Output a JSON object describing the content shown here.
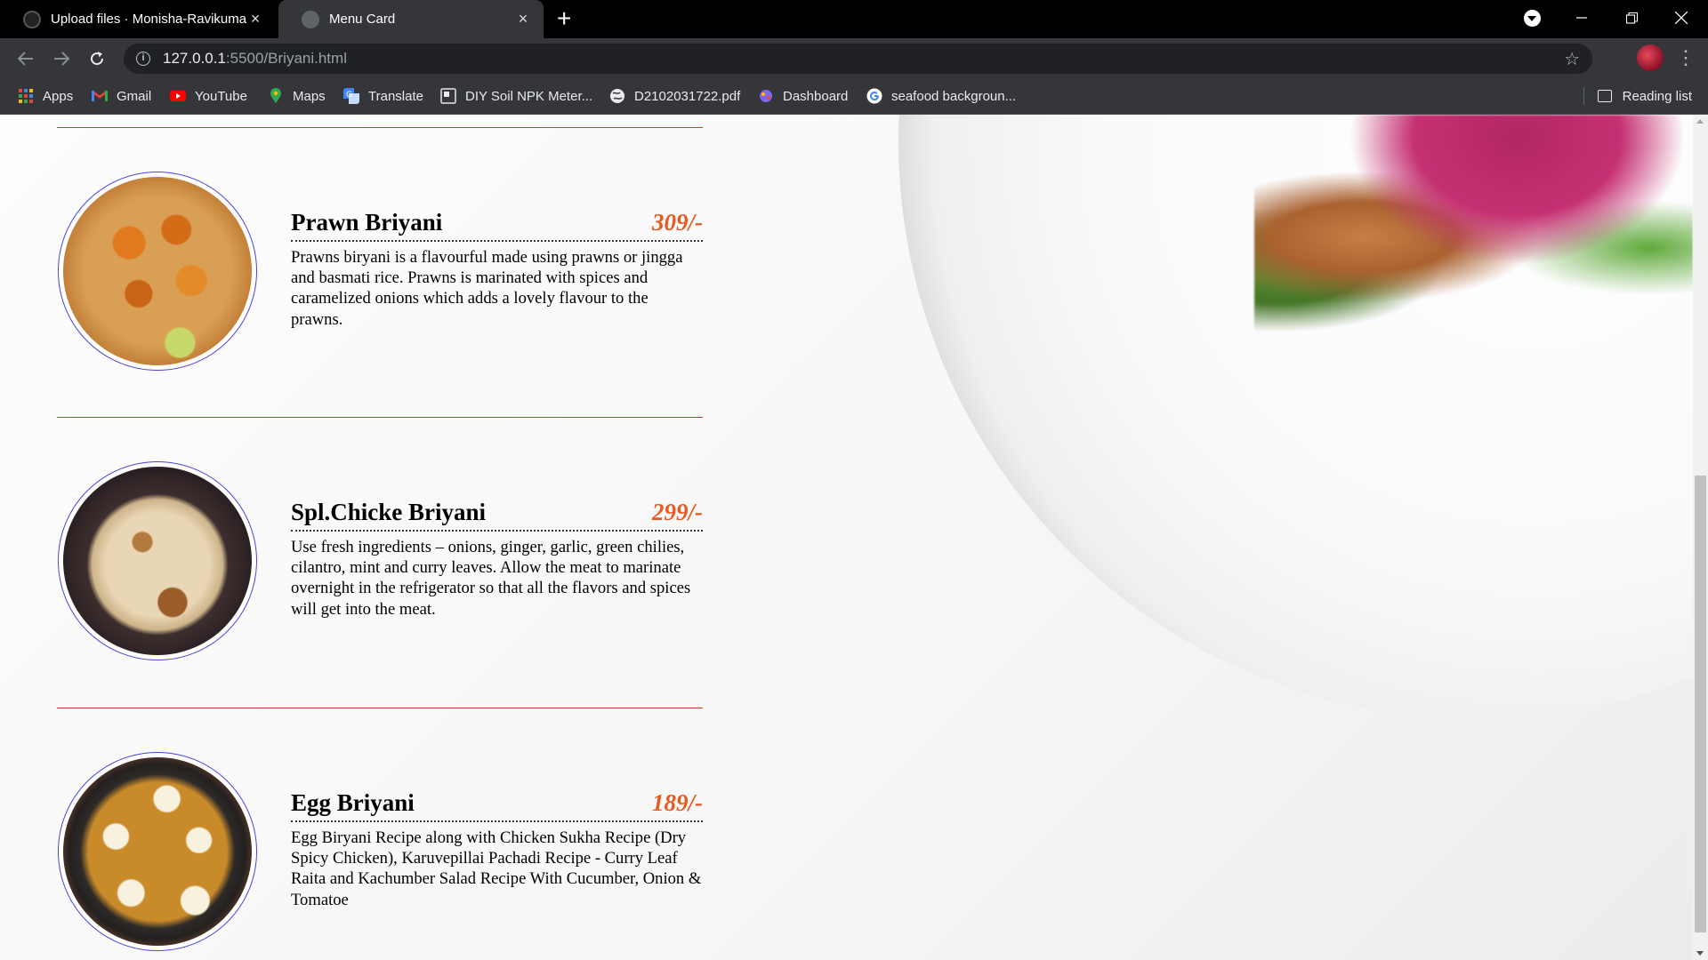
{
  "browser": {
    "tabs": [
      {
        "title": "Upload files · Monisha-Ravikumar",
        "active": false,
        "close": "×",
        "favicon": "github-icon"
      },
      {
        "title": "Menu Card",
        "active": true,
        "close": "×",
        "favicon": "globe-icon"
      }
    ],
    "new_tab": "+",
    "url_host": "127.0.0.1",
    "url_path": ":5500/Briyani.html",
    "bookmarks": [
      {
        "label": "Apps",
        "icon": "apps-grid-icon",
        "color": "#ea4335"
      },
      {
        "label": "Gmail",
        "icon": "gmail-icon",
        "color": "#ea4335"
      },
      {
        "label": "YouTube",
        "icon": "youtube-icon",
        "color": "#ff0000"
      },
      {
        "label": "Maps",
        "icon": "maps-pin-icon",
        "color": "#34a853"
      },
      {
        "label": "Translate",
        "icon": "translate-icon",
        "color": "#4285f4"
      },
      {
        "label": "DIY Soil NPK Meter...",
        "icon": "page-icon",
        "color": "#9aa0a6"
      },
      {
        "label": "D2102031722.pdf",
        "icon": "globe-icon",
        "color": "#e8eaed"
      },
      {
        "label": "Dashboard",
        "icon": "dashboard-icon",
        "color": "#7b68ee"
      },
      {
        "label": "seafood backgroun...",
        "icon": "google-icon",
        "color": "#4285f4"
      }
    ],
    "reading_list": "Reading list"
  },
  "menu": {
    "items": [
      {
        "name": "Prawn Briyani",
        "price": "309/-",
        "description": "Prawns biryani is a flavourful made using prawns or jingga and basmati rice. Prawns is marinated with spices and caramelized onions which adds a lovely flavour to the prawns."
      },
      {
        "name": "Spl.Chicke Briyani",
        "price": "299/-",
        "description": "Use fresh ingredients – onions, ginger, garlic, green chilies, cilantro, mint and curry leaves. Allow the meat to marinate overnight in the refrigerator so that all the flavors and spices will get into the meat."
      },
      {
        "name": "Egg Briyani",
        "price": "189/-",
        "description": "Egg Biryani Recipe along with Chicken Sukha Recipe (Dry Spicy Chicken), Karuvepillai Pachadi Recipe - Curry Leaf Raita and Kachumber Salad Recipe With Cucumber, Onion & Tomatoe"
      }
    ],
    "colors": {
      "price": "#e85a1f",
      "divider": "#d93838",
      "photo_border": "#4a43e0"
    }
  }
}
